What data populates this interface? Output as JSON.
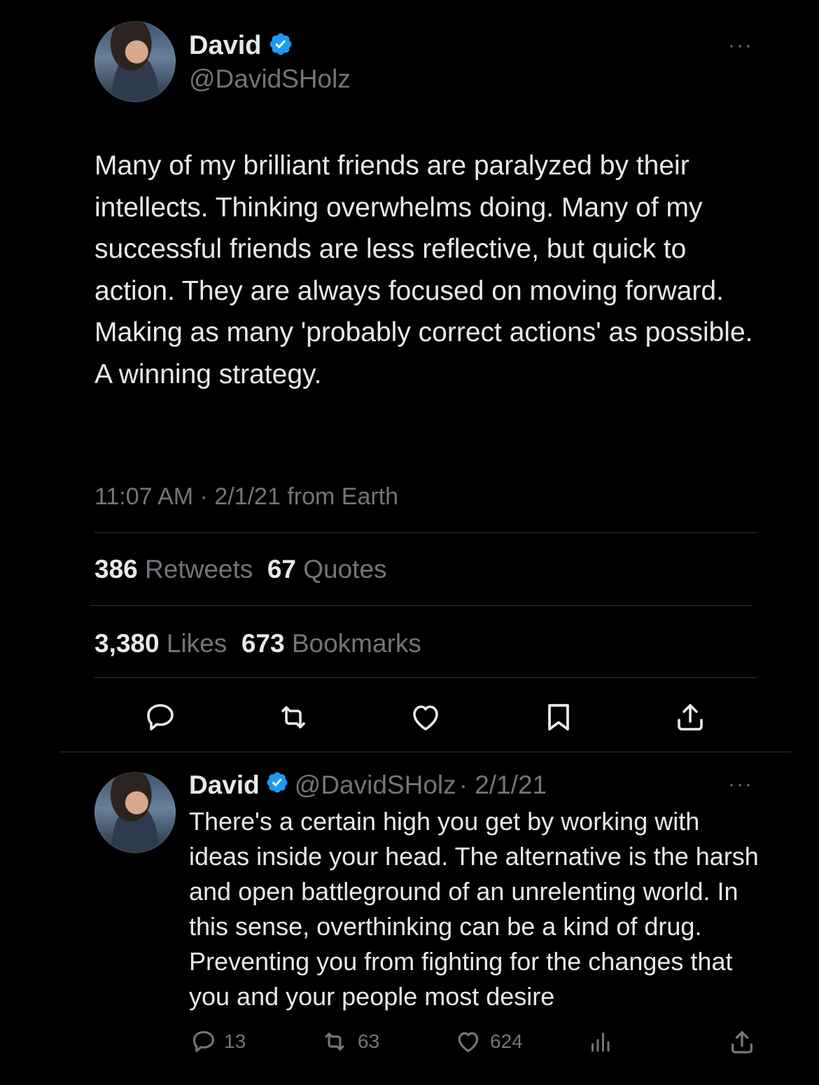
{
  "main_tweet": {
    "author_name": "David",
    "author_handle": "@DavidSHolz",
    "text": "Many of my brilliant friends are paralyzed by their intellects. Thinking overwhelms doing. Many of my successful friends are less reflective, but quick to action. They are always focused on moving forward. Making as many 'probably correct actions' as possible. A winning strategy.",
    "timestamp": "11:07 AM · 2/1/21 from Earth",
    "stats": {
      "retweets_count": "386",
      "retweets_label": "Retweets",
      "quotes_count": "67",
      "quotes_label": "Quotes",
      "likes_count": "3,380",
      "likes_label": "Likes",
      "bookmarks_count": "673",
      "bookmarks_label": "Bookmarks"
    },
    "more_label": "···"
  },
  "reply_tweet": {
    "author_name": "David",
    "author_handle": "@DavidSHolz",
    "date": "· 2/1/21",
    "text": "There's a certain high you get by working with ideas inside your head. The alternative is the harsh and open battleground of an unrelenting world. In this sense, overthinking can be a kind of drug. Preventing you from fighting for the changes that you and your people most desire",
    "replies": "13",
    "retweets": "63",
    "likes": "624",
    "more_label": "···"
  },
  "colors": {
    "background": "#000000",
    "text": "#e7e9ea",
    "secondary": "#71767b",
    "verified": "#1d9bf0",
    "divider": "#2f3336"
  },
  "icons": [
    "verified-badge-icon",
    "more-icon",
    "reply-icon",
    "retweet-icon",
    "like-icon",
    "bookmark-icon",
    "share-icon",
    "views-icon"
  ]
}
